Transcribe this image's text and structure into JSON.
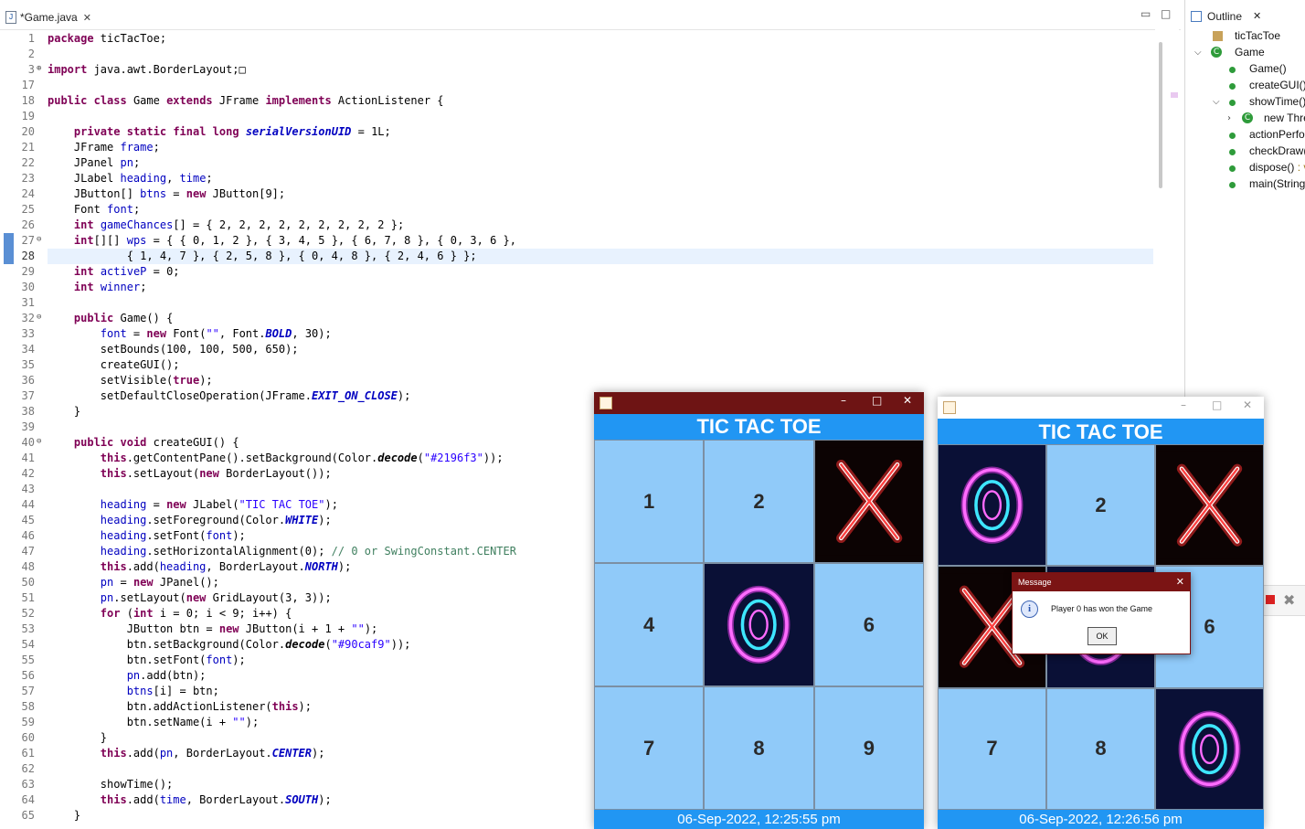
{
  "editor": {
    "tab_label": "*Game.java",
    "tab_close": "✕",
    "minimize": "▭",
    "maximize": "□",
    "current_line": 28,
    "lines": [
      {
        "n": "1",
        "t": "package ticTacToe;"
      },
      {
        "n": "2",
        "t": ""
      },
      {
        "n": "3",
        "t": "import java.awt.BorderLayout;□",
        "fold": "⊕"
      },
      {
        "n": "17",
        "t": ""
      },
      {
        "n": "18",
        "t": "public class Game extends JFrame implements ActionListener {"
      },
      {
        "n": "19",
        "t": ""
      },
      {
        "n": "20",
        "t": "    private static final long serialVersionUID = 1L;"
      },
      {
        "n": "21",
        "t": "    JFrame frame;"
      },
      {
        "n": "22",
        "t": "    JPanel pn;"
      },
      {
        "n": "23",
        "t": "    JLabel heading, time;"
      },
      {
        "n": "24",
        "t": "    JButton[] btns = new JButton[9];"
      },
      {
        "n": "25",
        "t": "    Font font;"
      },
      {
        "n": "26",
        "t": "    int gameChances[] = { 2, 2, 2, 2, 2, 2, 2, 2, 2 };"
      },
      {
        "n": "27",
        "t": "    int[][] wps = { { 0, 1, 2 }, { 3, 4, 5 }, { 6, 7, 8 }, { 0, 3, 6 },",
        "fold": "⊖"
      },
      {
        "n": "28",
        "t": "            { 1, 4, 7 }, { 2, 5, 8 }, { 0, 4, 8 }, { 2, 4, 6 } };"
      },
      {
        "n": "29",
        "t": "    int activeP = 0;"
      },
      {
        "n": "30",
        "t": "    int winner;"
      },
      {
        "n": "31",
        "t": ""
      },
      {
        "n": "32",
        "t": "    public Game() {",
        "fold": "⊖"
      },
      {
        "n": "33",
        "t": "        font = new Font(\"\", Font.BOLD, 30);"
      },
      {
        "n": "34",
        "t": "        setBounds(100, 100, 500, 650);"
      },
      {
        "n": "35",
        "t": "        createGUI();"
      },
      {
        "n": "36",
        "t": "        setVisible(true);"
      },
      {
        "n": "37",
        "t": "        setDefaultCloseOperation(JFrame.EXIT_ON_CLOSE);"
      },
      {
        "n": "38",
        "t": "    }"
      },
      {
        "n": "39",
        "t": ""
      },
      {
        "n": "40",
        "t": "    public void createGUI() {",
        "fold": "⊖"
      },
      {
        "n": "41",
        "t": "        this.getContentPane().setBackground(Color.decode(\"#2196f3\"));"
      },
      {
        "n": "42",
        "t": "        this.setLayout(new BorderLayout());"
      },
      {
        "n": "43",
        "t": ""
      },
      {
        "n": "44",
        "t": "        heading = new JLabel(\"TIC TAC TOE\");"
      },
      {
        "n": "45",
        "t": "        heading.setForeground(Color.WHITE);"
      },
      {
        "n": "46",
        "t": "        heading.setFont(font);"
      },
      {
        "n": "47",
        "t": "        heading.setHorizontalAlignment(0); // 0 or SwingConstant.CENTER"
      },
      {
        "n": "48",
        "t": "        this.add(heading, BorderLayout.NORTH);"
      },
      {
        "n": "50",
        "t": "        pn = new JPanel();"
      },
      {
        "n": "51",
        "t": "        pn.setLayout(new GridLayout(3, 3));"
      },
      {
        "n": "52",
        "t": "        for (int i = 0; i < 9; i++) {"
      },
      {
        "n": "53",
        "t": "            JButton btn = new JButton(i + 1 + \"\");"
      },
      {
        "n": "54",
        "t": "            btn.setBackground(Color.decode(\"#90caf9\"));"
      },
      {
        "n": "55",
        "t": "            btn.setFont(font);"
      },
      {
        "n": "56",
        "t": "            pn.add(btn);"
      },
      {
        "n": "57",
        "t": "            btns[i] = btn;"
      },
      {
        "n": "58",
        "t": "            btn.addActionListener(this);"
      },
      {
        "n": "59",
        "t": "            btn.setName(i + \"\");"
      },
      {
        "n": "60",
        "t": "        }"
      },
      {
        "n": "61",
        "t": "        this.add(pn, BorderLayout.CENTER);"
      },
      {
        "n": "62",
        "t": ""
      },
      {
        "n": "63",
        "t": "        showTime();"
      },
      {
        "n": "64",
        "t": "        this.add(time, BorderLayout.SOUTH);"
      },
      {
        "n": "65",
        "t": "    }"
      }
    ]
  },
  "outline": {
    "title": "Outline",
    "close": "✕",
    "items": [
      {
        "label": "ticTacToe"
      },
      {
        "label": "Game"
      },
      {
        "label": "Game()"
      },
      {
        "label": "createGUI()"
      },
      {
        "label": "showTime()"
      },
      {
        "label": "new Thre"
      },
      {
        "label": "actionPerfo"
      },
      {
        "label": "checkDraw("
      },
      {
        "label": "dispose()",
        "ret": " : v"
      },
      {
        "label": "main(String"
      }
    ]
  },
  "game_left": {
    "heading": "TIC TAC TOE",
    "cells": [
      "1",
      "2",
      "X",
      "4",
      "O",
      "6",
      "7",
      "8",
      "9"
    ],
    "time": "06-Sep-2022, 12:25:55 pm",
    "controls": {
      "min": "–",
      "max": "□",
      "close": "✕"
    }
  },
  "game_right": {
    "heading": "TIC TAC TOE",
    "cells": [
      "O",
      "2",
      "X",
      "X",
      "O",
      "6",
      "7",
      "8",
      "O"
    ],
    "time": "06-Sep-2022, 12:26:56 pm",
    "controls": {
      "min": "–",
      "max": "□",
      "close": "✕"
    }
  },
  "dialog": {
    "title": "Message",
    "close": "✕",
    "icon": "i",
    "message": "Player 0 has won the Game",
    "ok": "OK"
  },
  "colors": {
    "heading_bg": "#2196f3",
    "cell_bg": "#90caf9",
    "titlebar_dark": "#6e1414",
    "keyword": "#7f0055",
    "field": "#0000c0",
    "string": "#2a00ff",
    "comment": "#3f7f5f"
  }
}
